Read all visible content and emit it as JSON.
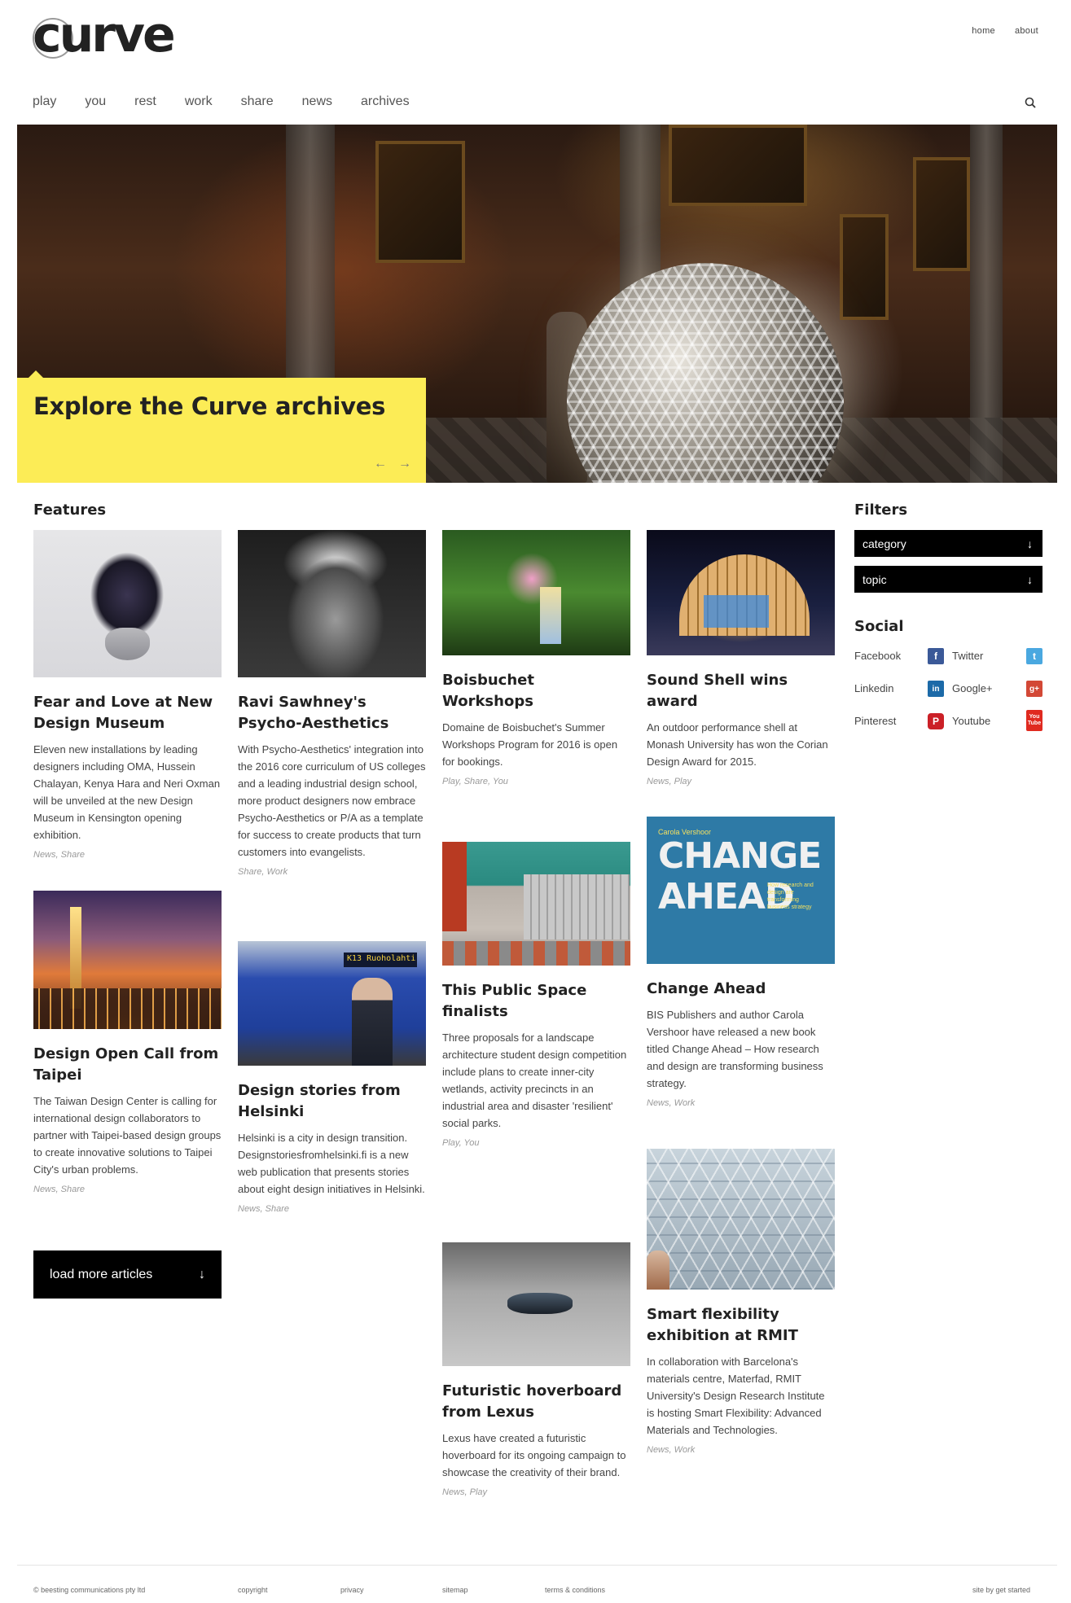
{
  "header": {
    "logo": "curve",
    "toplinks": [
      "home",
      "about"
    ],
    "nav": [
      "play",
      "you",
      "rest",
      "work",
      "share",
      "news",
      "archives"
    ]
  },
  "hero": {
    "title": "Explore the Curve archives",
    "prev": "←",
    "next": "→"
  },
  "features": {
    "title": "Features",
    "cards": [
      {
        "title": "Fear and Love at New Design Museum",
        "desc": "Eleven new installations by leading designers including OMA, Hussein Chalayan, Kenya Hara and Neri Oxman will be unveiled at the new Design Museum in Kensington opening exhibition.",
        "tags": "News, Share"
      },
      {
        "title": "Ravi Sawhney's Psycho-Aesthetics",
        "desc": "With Psycho-Aesthetics' integration into the 2016 core curriculum of US colleges and a leading industrial design school, more product designers now embrace Psycho-Aesthetics or P/A as a template for success to create products that turn customers into evangelists.",
        "tags": "Share, Work"
      },
      {
        "title": "Boisbuchet Workshops",
        "desc": "Domaine de Boisbuchet's Summer Workshops Program for 2016 is open for bookings.",
        "tags": "Play, Share, You"
      },
      {
        "title": "Sound Shell wins award",
        "desc": "An outdoor performance shell at Monash University has won the Corian Design Award for 2015.",
        "tags": "News, Play"
      },
      {
        "title": "Design Open Call from Taipei",
        "desc": "The Taiwan Design Center is calling for international design collaborators to partner with Taipei-based design groups to create innovative solutions to Taipei City's urban problems.",
        "tags": "News, Share"
      },
      {
        "title": "Design stories from Helsinki",
        "desc": "Helsinki is a city in design transition. Designstoriesfromhelsinki.fi is a new web publication that presents stories about eight design initiatives in Helsinki.",
        "tags": "News, Share",
        "bus_sign": "K13 Ruoholahti"
      },
      {
        "title": "This Public Space finalists",
        "desc": "Three proposals for a landscape architecture student design competition include plans to create inner-city wetlands, activity precincts in an industrial area and disaster 'resilient' social parks.",
        "tags": "Play, You"
      },
      {
        "title": "Change Ahead",
        "desc": "BIS Publishers and author Carola Vershoor have released a new book titled Change Ahead – How research and design are transforming business strategy.",
        "tags": "News, Work",
        "book": {
          "author": "Carola Vershoor",
          "line1": "CHANGE",
          "line2": "AHEAD",
          "sub": "How research and design are transforming business strategy"
        }
      },
      {
        "title": "Futuristic hoverboard from Lexus",
        "desc": "Lexus have created a futuristic hoverboard for its ongoing campaign to showcase the creativity of their brand.",
        "tags": "News, Play"
      },
      {
        "title": "Smart flexibility exhibition at RMIT",
        "desc": "In collaboration with Barcelona's materials centre, Materfad, RMIT University's Design Research Institute is hosting Smart Flexibility: Advanced Materials and Technologies.",
        "tags": "News, Work"
      }
    ],
    "load_more": "load more articles",
    "load_more_icon": "↓"
  },
  "sidebar": {
    "filters_title": "Filters",
    "filters": [
      {
        "label": "category",
        "icon": "↓"
      },
      {
        "label": "topic",
        "icon": "↓"
      }
    ],
    "social_title": "Social",
    "social": [
      {
        "label": "Facebook",
        "icon": "f",
        "color": "#3b5998"
      },
      {
        "label": "Twitter",
        "icon": "t",
        "color": "#4aa8e0"
      },
      {
        "label": "Linkedin",
        "icon": "in",
        "color": "#1c6aa8"
      },
      {
        "label": "Google+",
        "icon": "g+",
        "color": "#d34836"
      },
      {
        "label": "Pinterest",
        "icon": "P",
        "color": "#cb2027"
      },
      {
        "label": "Youtube",
        "icon": "You Tube",
        "color": "#e02a20"
      }
    ]
  },
  "footer": {
    "copyright_owner": "© beesting communications pty ltd",
    "links": [
      "copyright",
      "privacy",
      "sitemap",
      "terms & conditions"
    ],
    "credit": "site by get started"
  },
  "colors": {
    "accent_yellow": "#fcec56",
    "black": "#000000"
  }
}
